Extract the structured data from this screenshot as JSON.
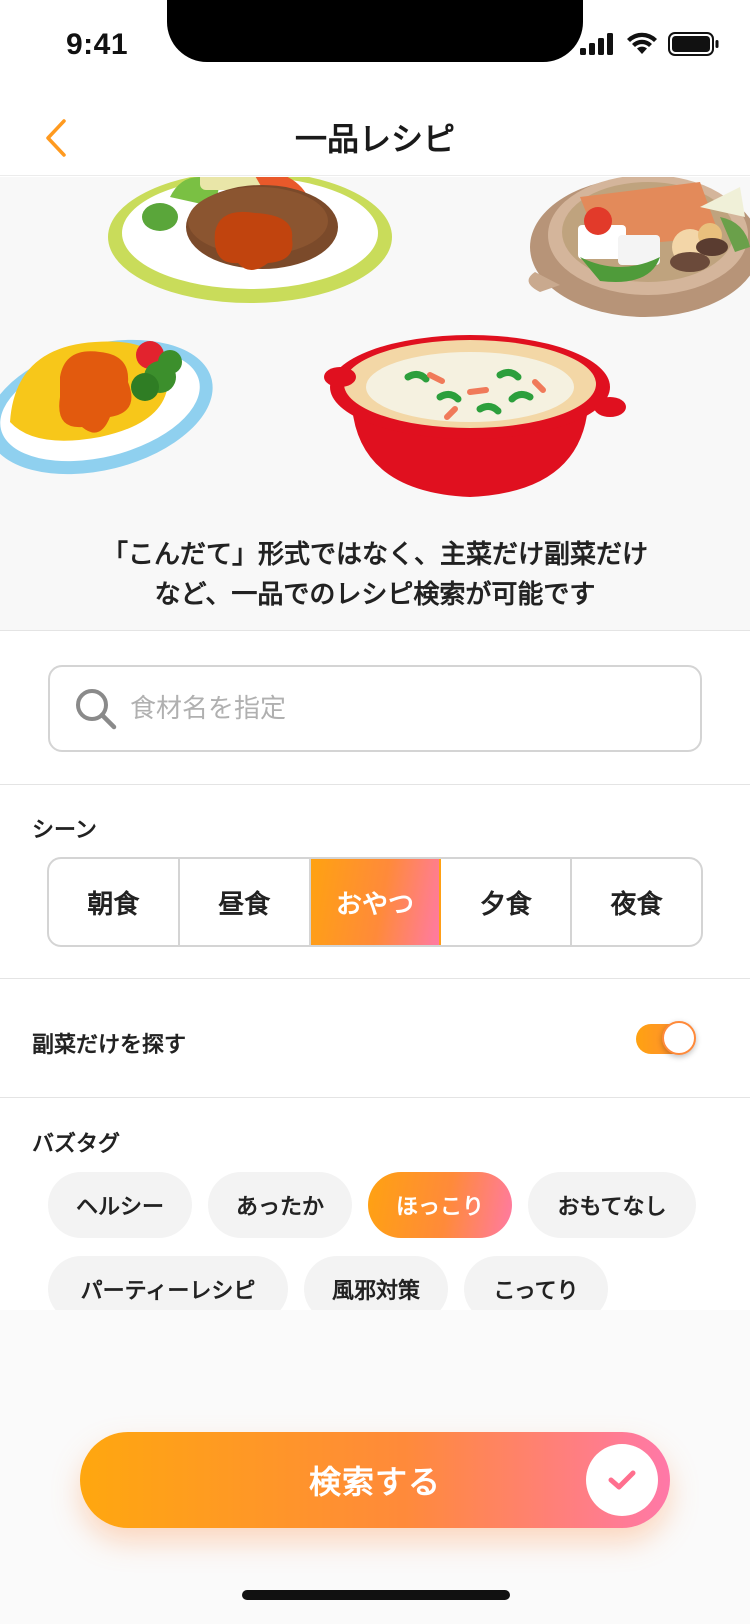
{
  "status_bar": {
    "time": "9:41"
  },
  "nav": {
    "title": "一品レシピ"
  },
  "hero": {
    "description_line1": "「こんだて」形式ではなく、主菜だけ副菜だけ",
    "description_line2": "など、一品でのレシピ検索が可能です"
  },
  "search": {
    "placeholder": "食材名を指定",
    "value": ""
  },
  "scene": {
    "label": "シーン",
    "options": [
      "朝食",
      "昼食",
      "おやつ",
      "夕食",
      "夜食"
    ],
    "selected": "おやつ"
  },
  "side_dish_toggle": {
    "label": "副菜だけを探す",
    "on": true
  },
  "buzz_tags": {
    "label": "バズタグ",
    "tags": [
      "ヘルシー",
      "あったか",
      "ほっこり",
      "おもてなし",
      "パーティーレシピ",
      "風邪対策",
      "こってり"
    ],
    "selected": "ほっこり"
  },
  "submit": {
    "label": "検索する"
  },
  "colors": {
    "accent_orange": "#ffa211",
    "accent_pink": "#ff7aa3",
    "back_arrow": "#ff9a1f"
  }
}
